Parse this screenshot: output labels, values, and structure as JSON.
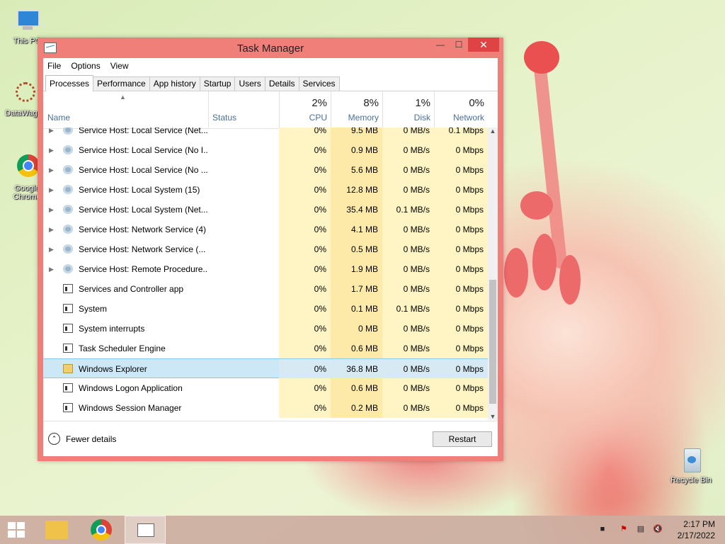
{
  "desktop": {
    "icons": [
      {
        "label": "This PC"
      },
      {
        "label": "DataWagon"
      },
      {
        "label": "Google Chrome"
      },
      {
        "label": "Recycle Bin"
      }
    ]
  },
  "window": {
    "title": "Task Manager",
    "controls": {
      "minimize": "—",
      "maximize": "☐",
      "close": "✕"
    },
    "menu": [
      "File",
      "Options",
      "View"
    ],
    "tabs": [
      "Processes",
      "Performance",
      "App history",
      "Startup",
      "Users",
      "Details",
      "Services"
    ],
    "active_tab": "Processes",
    "columns": {
      "name": "Name",
      "status": "Status",
      "cpu": {
        "pct": "2%",
        "label": "CPU"
      },
      "memory": {
        "pct": "8%",
        "label": "Memory"
      },
      "disk": {
        "pct": "1%",
        "label": "Disk"
      },
      "network": {
        "pct": "0%",
        "label": "Network"
      }
    },
    "rows": [
      {
        "name": "Service Host: Local Service (Net...",
        "cpu": "0%",
        "mem": "9.5 MB",
        "disk": "0 MB/s",
        "net": "0.1 Mbps",
        "expandable": true,
        "icon": "gear"
      },
      {
        "name": "Service Host: Local Service (No I...",
        "cpu": "0%",
        "mem": "0.9 MB",
        "disk": "0 MB/s",
        "net": "0 Mbps",
        "expandable": true,
        "icon": "gear"
      },
      {
        "name": "Service Host: Local Service (No ...",
        "cpu": "0%",
        "mem": "5.6 MB",
        "disk": "0 MB/s",
        "net": "0 Mbps",
        "expandable": true,
        "icon": "gear"
      },
      {
        "name": "Service Host: Local System (15)",
        "cpu": "0%",
        "mem": "12.8 MB",
        "disk": "0 MB/s",
        "net": "0 Mbps",
        "expandable": true,
        "icon": "gear"
      },
      {
        "name": "Service Host: Local System (Net...",
        "cpu": "0%",
        "mem": "35.4 MB",
        "disk": "0.1 MB/s",
        "net": "0 Mbps",
        "expandable": true,
        "icon": "gear"
      },
      {
        "name": "Service Host: Network Service (4)",
        "cpu": "0%",
        "mem": "4.1 MB",
        "disk": "0 MB/s",
        "net": "0 Mbps",
        "expandable": true,
        "icon": "gear"
      },
      {
        "name": "Service Host: Network Service (...",
        "cpu": "0%",
        "mem": "0.5 MB",
        "disk": "0 MB/s",
        "net": "0 Mbps",
        "expandable": true,
        "icon": "gear"
      },
      {
        "name": "Service Host: Remote Procedure...",
        "cpu": "0%",
        "mem": "1.9 MB",
        "disk": "0 MB/s",
        "net": "0 Mbps",
        "expandable": true,
        "icon": "gear"
      },
      {
        "name": "Services and Controller app",
        "cpu": "0%",
        "mem": "1.7 MB",
        "disk": "0 MB/s",
        "net": "0 Mbps",
        "expandable": false,
        "icon": "app"
      },
      {
        "name": "System",
        "cpu": "0%",
        "mem": "0.1 MB",
        "disk": "0.1 MB/s",
        "net": "0 Mbps",
        "expandable": false,
        "icon": "app"
      },
      {
        "name": "System interrupts",
        "cpu": "0%",
        "mem": "0 MB",
        "disk": "0 MB/s",
        "net": "0 Mbps",
        "expandable": false,
        "icon": "app"
      },
      {
        "name": "Task Scheduler Engine",
        "cpu": "0%",
        "mem": "0.6 MB",
        "disk": "0 MB/s",
        "net": "0 Mbps",
        "expandable": false,
        "icon": "app"
      },
      {
        "name": "Windows Explorer",
        "cpu": "0%",
        "mem": "36.8 MB",
        "disk": "0 MB/s",
        "net": "0 Mbps",
        "expandable": false,
        "icon": "folder",
        "selected": true
      },
      {
        "name": "Windows Logon Application",
        "cpu": "0%",
        "mem": "0.6 MB",
        "disk": "0 MB/s",
        "net": "0 Mbps",
        "expandable": false,
        "icon": "app"
      },
      {
        "name": "Windows Session Manager",
        "cpu": "0%",
        "mem": "0.2 MB",
        "disk": "0 MB/s",
        "net": "0 Mbps",
        "expandable": false,
        "icon": "app"
      }
    ],
    "footer": {
      "fewer_details": "Fewer details",
      "restart": "Restart"
    }
  },
  "taskbar": {
    "clock_time": "2:17 PM",
    "clock_date": "2/17/2022"
  }
}
